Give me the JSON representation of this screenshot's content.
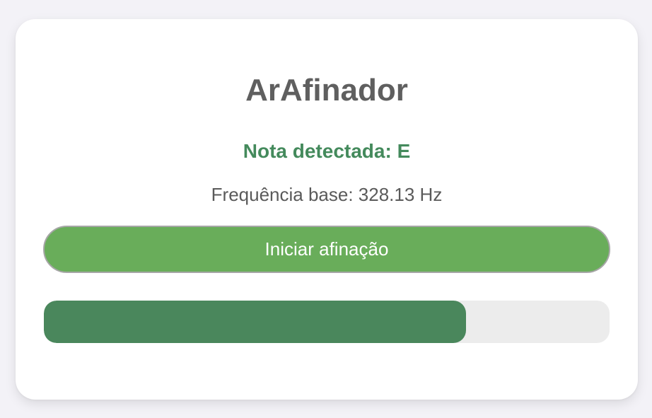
{
  "app": {
    "title": "ArAfinador"
  },
  "tuner": {
    "note_text": "Nota detectada: E",
    "frequency_text": "Frequência base: 328.13 Hz",
    "start_button_label": "Iniciar afinação",
    "progress_fraction": 0.746
  },
  "colors": {
    "background": "#f3f2f7",
    "card": "#ffffff",
    "title": "#5f5f5f",
    "note": "#448a5c",
    "button": "#69ad5a",
    "progress_fill": "#4a875c",
    "progress_track": "#ececec"
  }
}
